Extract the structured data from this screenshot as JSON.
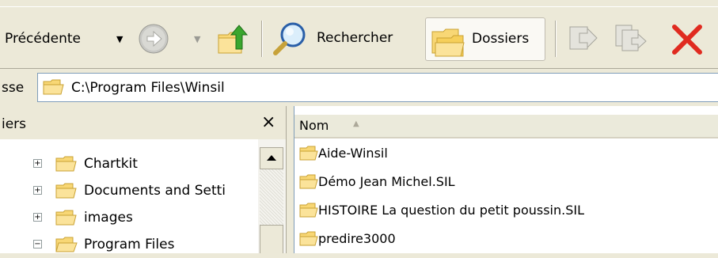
{
  "toolbar": {
    "back_label": "Précédente",
    "search_label": "Rechercher",
    "folders_label": "Dossiers"
  },
  "address": {
    "label_partial": "sse",
    "path": "C:\\Program Files\\Winsil"
  },
  "folders_pane": {
    "title_partial": "iers",
    "close_glyph": "×",
    "tree": [
      {
        "label": "Chartkit",
        "expander": "+"
      },
      {
        "label": "Documents and Setti",
        "expander": "+"
      },
      {
        "label": "images",
        "expander": "+"
      },
      {
        "label": "Program Files",
        "expander": "−"
      }
    ]
  },
  "file_list": {
    "column_name": "Nom",
    "sort_glyph": "▲",
    "items": [
      {
        "name": "Aide-Winsil"
      },
      {
        "name": "Démo Jean Michel.SIL"
      },
      {
        "name": "HISTOIRE La question du petit poussin.SIL"
      },
      {
        "name": "predire3000"
      }
    ]
  },
  "colors": {
    "chrome": "#ece9d8",
    "folder_fill": "#f8d775",
    "folder_edge": "#c9a233",
    "delete_red": "#e02b20",
    "address_border": "#7f9db9"
  }
}
